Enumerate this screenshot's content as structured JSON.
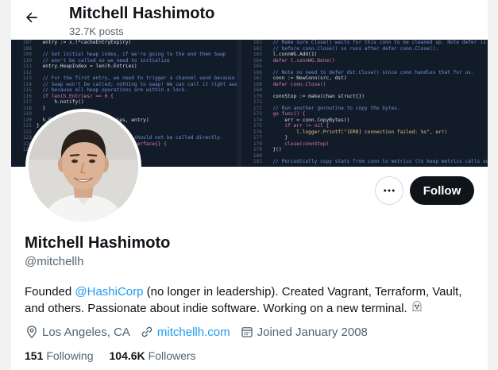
{
  "header": {
    "name": "Mitchell Hashimoto",
    "posts": "32.7K posts"
  },
  "banner": {
    "left_code": [
      {
        "n": "187",
        "t": "  entry := x.(*cacheEntryExpiry)",
        "k": "plain"
      },
      {
        "n": "188",
        "t": "",
        "k": "plain"
      },
      {
        "n": "109",
        "t": "  // Set initial heap index, if we're going to the end then Swap",
        "k": "comment"
      },
      {
        "n": "110",
        "t": "  // won't be called so we need to initialize",
        "k": "comment"
      },
      {
        "n": "111",
        "t": "  entry.HeapIndex = len(h.Entries)",
        "k": "plain"
      },
      {
        "n": "112",
        "t": "",
        "k": "plain"
      },
      {
        "n": "113",
        "t": "  // For the first entry, we need to trigger a channel send because",
        "k": "comment"
      },
      {
        "n": "114",
        "t": "  // Swap won't be called; nothing to swap! We can call it right away",
        "k": "comment"
      },
      {
        "n": "115",
        "t": "  // because all heap operations are within a lock.",
        "k": "comment"
      },
      {
        "n": "116",
        "t": "  if len(h.Entries) == 0 {",
        "k": "keyword"
      },
      {
        "n": "117",
        "t": "      h.notify()",
        "k": "plain"
      },
      {
        "n": "118",
        "t": "  }",
        "k": "plain"
      },
      {
        "n": "119",
        "t": "",
        "k": "plain"
      },
      {
        "n": "120",
        "t": "  h.Entries = append(h.Entries, entry)",
        "k": "plain"
      },
      {
        "n": "121",
        "t": "}",
        "k": "plain"
      },
      {
        "n": "122",
        "t": "",
        "k": "plain"
      },
      {
        "n": "123",
        "t": "// Pop is called by heap.Pop and should not be called directly.",
        "k": "comment"
      },
      {
        "n": "124",
        "t": "func (h *expiryHeapImpl) Pop() interface{} {",
        "k": "keyword"
      },
      {
        "n": "125",
        "t": "",
        "k": "plain"
      }
    ],
    "right_code": [
      {
        "n": "161",
        "t": "  // Make sure Close() waits for this conn to be cleaned up. Note defer is",
        "k": "comment"
      },
      {
        "n": "162",
        "t": "  // before conn.Close() so runs after defer conn.Close().",
        "k": "comment"
      },
      {
        "n": "163",
        "t": "  l.connWG.Add(1)",
        "k": "plain"
      },
      {
        "n": "164",
        "t": "  defer l.connWG.Done()",
        "k": "keyword"
      },
      {
        "n": "165",
        "t": "",
        "k": "plain"
      },
      {
        "n": "166",
        "t": "  // Note no need to defer dst.Close() since conn handles that for us.",
        "k": "comment"
      },
      {
        "n": "167",
        "t": "  conn := NewConn(src, dst)",
        "k": "plain"
      },
      {
        "n": "168",
        "t": "  defer conn.Close()",
        "k": "keyword"
      },
      {
        "n": "169",
        "t": "",
        "k": "plain"
      },
      {
        "n": "170",
        "t": "  connStop := make(chan struct{})",
        "k": "plain"
      },
      {
        "n": "171",
        "t": "",
        "k": "plain"
      },
      {
        "n": "172",
        "t": "  // Run another goroutine to copy the bytes.",
        "k": "comment"
      },
      {
        "n": "173",
        "t": "  go func() {",
        "k": "keyword"
      },
      {
        "n": "174",
        "t": "      err = conn.CopyBytes()",
        "k": "plain"
      },
      {
        "n": "175",
        "t": "      if err != nil {",
        "k": "keyword"
      },
      {
        "n": "176",
        "t": "          l.logger.Printf(\"[ERR] connection failed: %s\", err)",
        "k": "string"
      },
      {
        "n": "177",
        "t": "      }",
        "k": "plain"
      },
      {
        "n": "178",
        "t": "      close(connStop)",
        "k": "keyword"
      },
      {
        "n": "179",
        "t": "  }()",
        "k": "plain"
      },
      {
        "n": "180",
        "t": "",
        "k": "plain"
      },
      {
        "n": "181",
        "t": "  // Periodically copy stats from conn to metrics (to keep metrics calls out of",
        "k": "comment"
      }
    ]
  },
  "actions": {
    "more_label": "More",
    "follow_label": "Follow"
  },
  "profile": {
    "display_name": "Mitchell Hashimoto",
    "handle": "@mitchellh",
    "bio_prefix": "Founded ",
    "bio_link": "@HashiCorp",
    "bio_suffix": " (no longer in leadership). Created Vagrant, Terraform, Vault, and others. Passionate about indie software. Working on a new terminal.",
    "location": "Los Angeles, CA",
    "website": "mitchellh.com",
    "joined": "Joined January 2008",
    "following_count": "151",
    "following_label": "Following",
    "followers_count": "104.6K",
    "followers_label": "Followers"
  },
  "colors": {
    "accent": "#1d9bf0",
    "text_primary": "#0f1419",
    "text_secondary": "#536471",
    "follow_bg": "#0f1419"
  },
  "icons": {
    "back": "arrow-left-icon",
    "more": "more-dots-icon",
    "location": "location-pin-icon",
    "link": "link-icon",
    "calendar": "calendar-icon",
    "bio_emoji": "ghost-emoji-icon"
  }
}
